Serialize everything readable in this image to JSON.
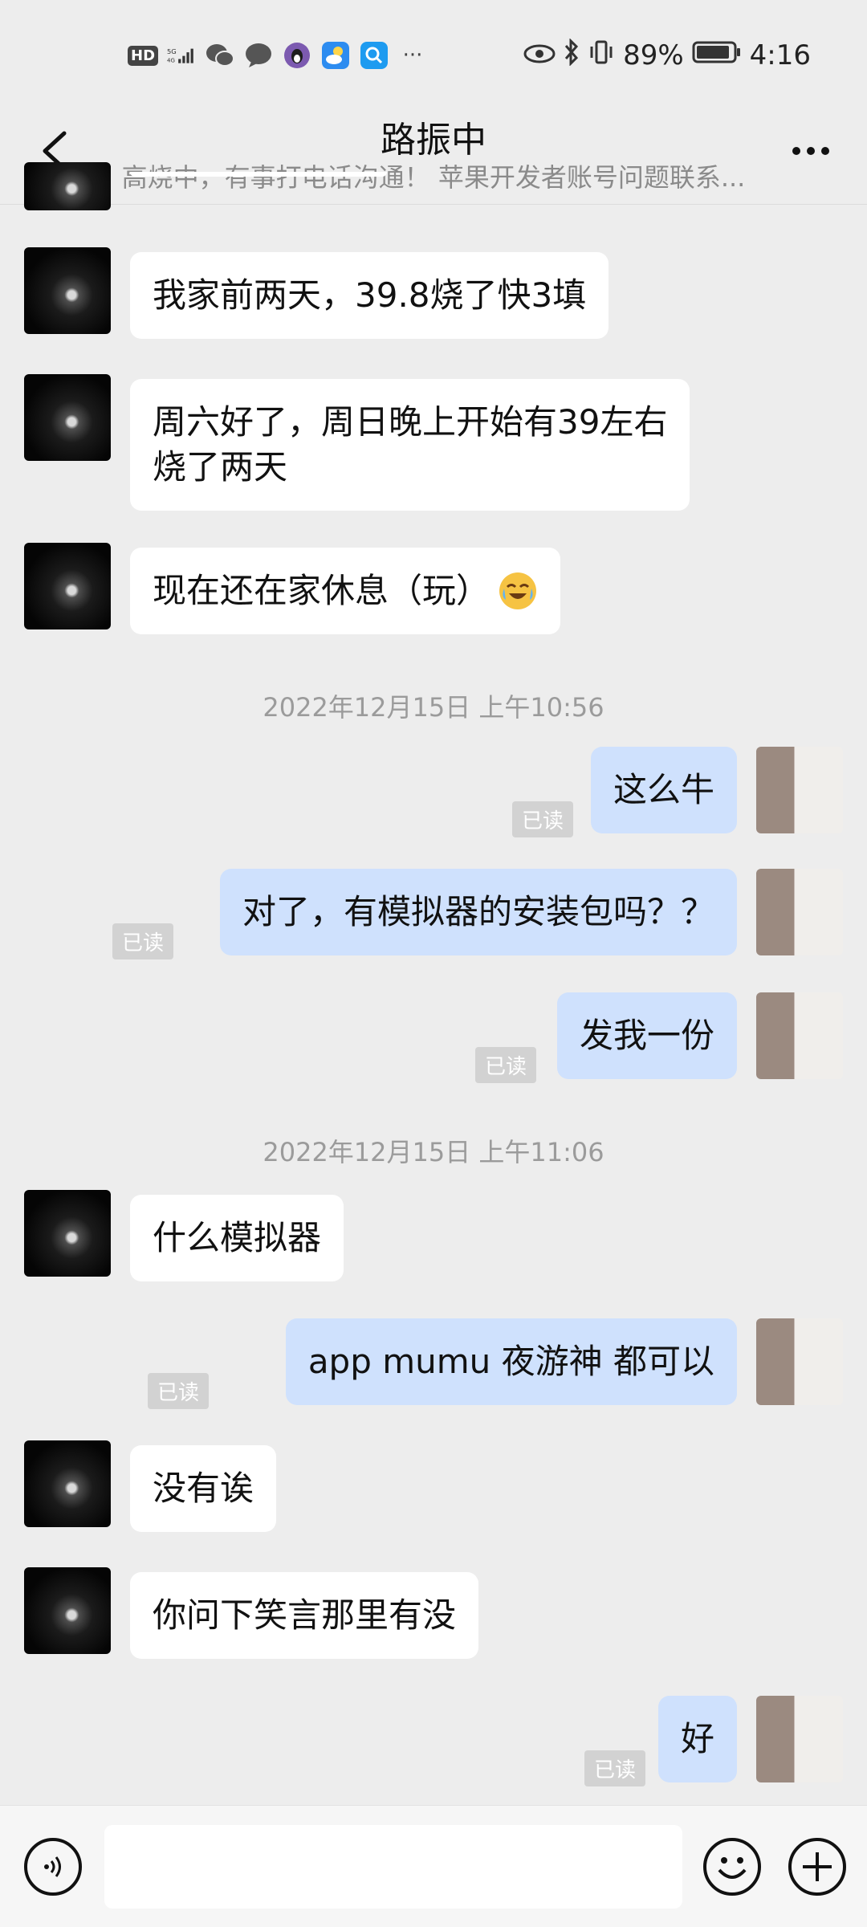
{
  "status_bar": {
    "icons_left": [
      "hd-icon",
      "5g-signal-icon",
      "wechat-icon",
      "chat-bubble-icon",
      "qq-icon",
      "weather-app-icon",
      "search-app-icon",
      "more-dots-icon"
    ],
    "hd_text": "HD",
    "more_text": "···",
    "battery": "89%",
    "time": "4:16"
  },
  "header": {
    "title": "路振中",
    "subtitle": "高烧中，有事打电话沟通！ 苹果开发者账号问题联系..."
  },
  "messages": [
    {
      "side": "left",
      "text": "我家前两天，39.8烧了快3填"
    },
    {
      "side": "left",
      "line1": "周六好了，周日晚上开始有39左右",
      "line2": "烧了两天"
    },
    {
      "side": "left",
      "text": "现在还在家休息（玩）"
    },
    {
      "type": "time",
      "text": "2022年12月15日 上午10:56"
    },
    {
      "side": "right",
      "text": "这么牛",
      "status": "已读"
    },
    {
      "side": "right",
      "text": "对了，有模拟器的安装包吗？？",
      "status": "已读"
    },
    {
      "side": "right",
      "text": "发我一份",
      "status": "已读"
    },
    {
      "type": "time",
      "text": "2022年12月15日 上午11:06"
    },
    {
      "side": "left",
      "text": "什么模拟器"
    },
    {
      "side": "right",
      "text": "app mumu 夜游神 都可以",
      "status": "已读"
    },
    {
      "side": "left",
      "text": "没有诶"
    },
    {
      "side": "left",
      "text": "你问下笑言那里有没"
    },
    {
      "side": "right",
      "text": "好",
      "status": "已读"
    }
  ],
  "input_bar": {
    "placeholder": ""
  },
  "colors": {
    "background": "#ededed",
    "bubble_left": "#ffffff",
    "bubble_right": "#cfe1fd",
    "read_badge": "#d2d2d2",
    "timestamp_text": "#9b9b9b"
  }
}
